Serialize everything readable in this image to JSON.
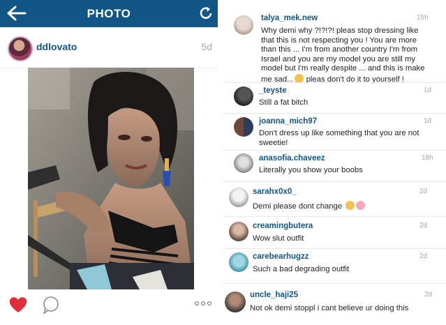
{
  "header": {
    "title": "PHOTO"
  },
  "post": {
    "username": "ddlovato",
    "time": "5d"
  },
  "comments": [
    {
      "user": "talya_mek.new",
      "time": "15h",
      "lines": [
        "Why demi why ?!?!?! pleas stop dressing like",
        "that this is not respecting you ! You are more",
        "than this ... I'm from another country I'm from",
        "Israel and you are my model you are still my",
        "model but I'm really despite ... and this is make",
        "me sad...",
        " pleas don't do it to yourself !"
      ]
    },
    {
      "user": "_teyste",
      "time": "1d",
      "lines": [
        "Still a fat bitch"
      ]
    },
    {
      "user": "joanna_mich97",
      "time": "1d",
      "lines": [
        "Don't dress up like something that you are not",
        "sweetie!"
      ]
    },
    {
      "user": "anasofia.chaveez",
      "time": "18h",
      "lines": [
        "Literally you show your boobs"
      ]
    },
    {
      "user": "sarahx0x0_",
      "time": "2d",
      "lines": [
        "Demi please dont change "
      ]
    },
    {
      "user": "creamingbutera",
      "time": "2d",
      "lines": [
        "Wow slut outfit"
      ]
    },
    {
      "user": "carebearhugzz",
      "time": "2d",
      "lines": [
        "Such a bad degrading outfit"
      ]
    },
    {
      "user": "uncle_haji25",
      "time": "2d",
      "lines": [
        "Not ok demi stoppl i cant believe ur doing this"
      ]
    }
  ],
  "icons": {
    "back": "back-arrow-icon",
    "refresh": "refresh-icon",
    "like": "heart-icon",
    "comment": "comment-bubble-icon",
    "more": "more-dots-icon"
  },
  "colors": {
    "header": "#125688",
    "like": "#e02e3a",
    "username": "#125688",
    "time": "#a5a7aa"
  }
}
